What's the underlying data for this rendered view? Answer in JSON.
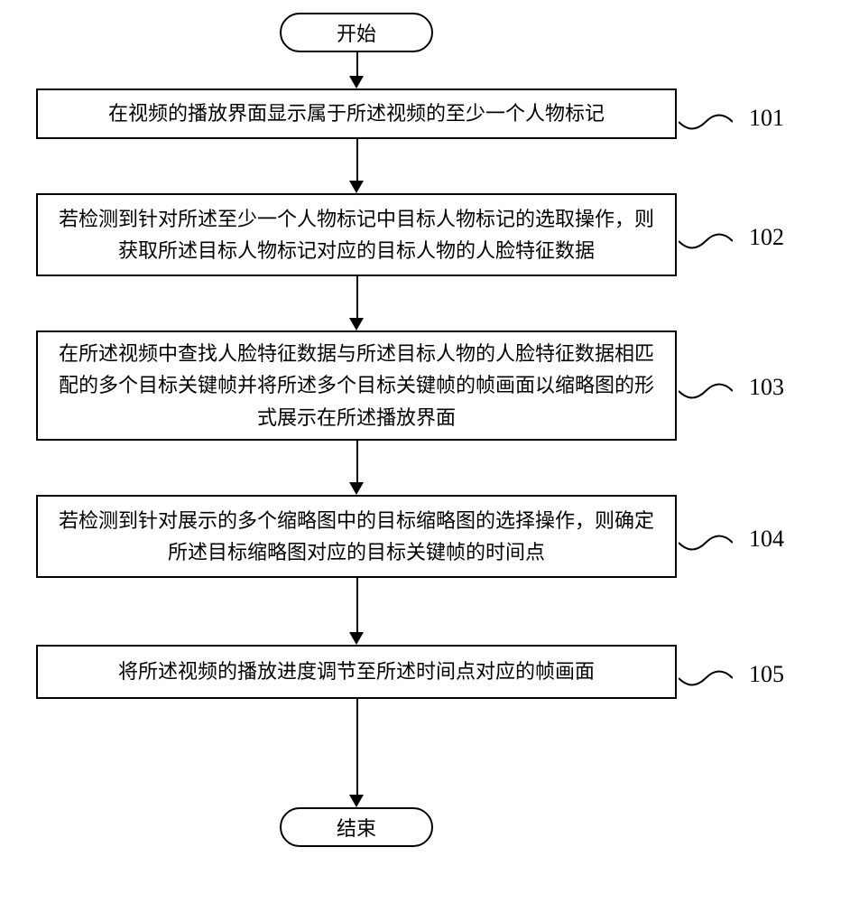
{
  "terminator": {
    "start": "开始",
    "end": "结束"
  },
  "steps": [
    {
      "label": "101",
      "text": "在视频的播放界面显示属于所述视频的至少一个人物标记"
    },
    {
      "label": "102",
      "text": "若检测到针对所述至少一个人物标记中目标人物标记的选取操作，则获取所述目标人物标记对应的目标人物的人脸特征数据"
    },
    {
      "label": "103",
      "text": "在所述视频中查找人脸特征数据与所述目标人物的人脸特征数据相匹配的多个目标关键帧并将所述多个目标关键帧的帧画面以缩略图的形式展示在所述播放界面"
    },
    {
      "label": "104",
      "text": "若检测到针对展示的多个缩略图中的目标缩略图的选择操作，则确定所述目标缩略图对应的目标关键帧的时间点"
    },
    {
      "label": "105",
      "text": "将所述视频的播放进度调节至所述时间点对应的帧画面"
    }
  ]
}
